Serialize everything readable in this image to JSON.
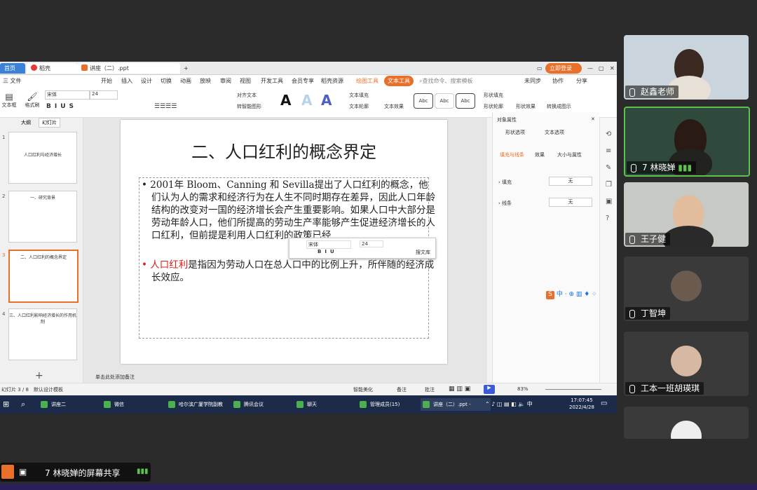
{
  "screen": {
    "tabs": [
      "首页",
      "稻壳",
      "讲座（二）.ppt"
    ],
    "login_button": "立即登录",
    "menu": [
      "三 文件",
      "开始",
      "插入",
      "设计",
      "切换",
      "动画",
      "放映",
      "审阅",
      "视图",
      "开发工具",
      "会员专享",
      "稻壳资源",
      "绘图工具",
      "文本工具"
    ],
    "search_placeholder": "查找命令、搜索模板",
    "right_menu": [
      "未同步",
      "协作",
      "分享"
    ],
    "toolbar": {
      "font_name": "宋体",
      "font_size": "24",
      "textbox": "文本框",
      "format_painter": "格式刷",
      "align_text": "对齐文本",
      "smart_graphic": "转智能图形",
      "text_fill": "文本填充",
      "text_outline": "文本轮廓",
      "text_effect": "文本效果",
      "abc": "Abc",
      "shape_fill": "形状填充",
      "shape_outline": "形状轮廓",
      "shape_effect": "形状效果",
      "convert_shape": "转换成图示"
    },
    "left_panel": {
      "tabs": [
        "大纲",
        "幻灯片"
      ],
      "thumbs": [
        {
          "num": "1",
          "title": "人口红利与经济增长"
        },
        {
          "num": "2",
          "title": "一、研究背景"
        },
        {
          "num": "3",
          "title": "二、人口红利的概念界定"
        },
        {
          "num": "4",
          "title": "三、人口红利影响经济增长的作用机制"
        }
      ]
    },
    "slide": {
      "title": "二、人口红利的概念界定",
      "para1": "2001年 Bloom、Canning 和 Sevilla提出了人口红利的概念，他们认为人的需求和经济行为在人生不同时期存在差异，因此人口年龄结构的改变对一国的经济增长会产生重要影响。如果人口中大部分是劳动年龄人口，他们所提高的劳动生产率能够产生促进经济增长的人口红利，但前提是利用人口红利的政策已经",
      "para2_red": "人口红利",
      "para2_rest": "是指因为劳动人口在总人口中的比例上升，所伴随的经济成长效应。",
      "mini_font": "宋体",
      "mini_size": "24",
      "mini_library": "搜文库"
    },
    "right_panel": {
      "title": "对象属性",
      "tabs": [
        "形状选项",
        "文本选项"
      ],
      "subtabs": [
        "填充与线条",
        "效果",
        "大小与属性"
      ],
      "fill_label": "填充",
      "fill_value": "无",
      "line_label": "线条",
      "line_value": "无"
    },
    "status": {
      "slide_num": "幻灯片 3 / 8",
      "theme": "默认设计模板",
      "notes_hint": "单击此处添加备注",
      "smart_beautify": "智能美化",
      "notes": "备注",
      "comment": "批注",
      "zoom": "83%"
    },
    "ime": "中",
    "taskbar": {
      "items": [
        "讲座二",
        "微信",
        "哈尔滨广厦学院副教",
        "腾讯会议",
        "聊天",
        "管理成员(15)",
        "讲座（二）.ppt -"
      ],
      "time": "17:07:45",
      "date": "2022/4/28",
      "lang": "中"
    }
  },
  "participants": [
    {
      "name": "赵鑫老师",
      "bg": "#c9d4dc"
    },
    {
      "name": "7 林晓婵",
      "bg": "#2f4a3c"
    },
    {
      "name": "王子健",
      "bg": "#c7c9c4"
    },
    {
      "name": "丁智坤",
      "bg": "#3a3a3a"
    },
    {
      "name": "工本一班胡瑛琪",
      "bg": "#3a3a3a"
    }
  ],
  "share_label": "7 林晓婵的屏幕共享",
  "colors": {
    "accent_orange": "#e8702a",
    "active_speaker": "#5bc24a",
    "taskbar": "#1c2b4a",
    "red_text": "#d9201f"
  }
}
